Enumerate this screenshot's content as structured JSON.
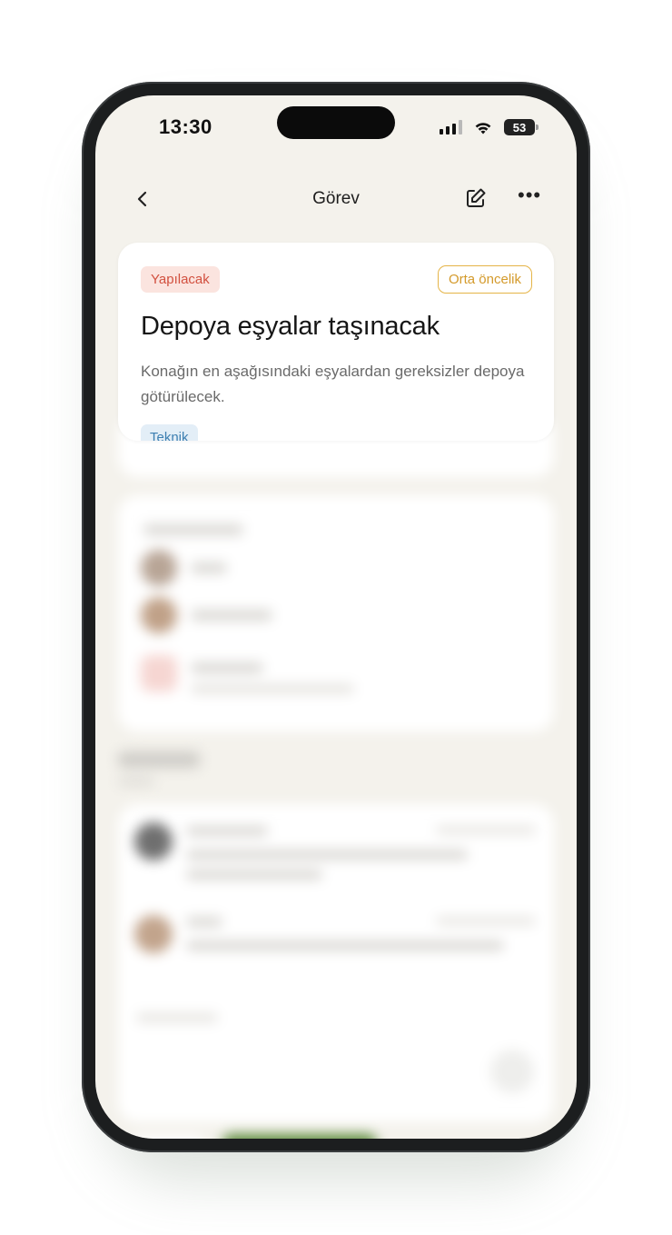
{
  "status_bar": {
    "time": "13:30",
    "battery": "53"
  },
  "nav": {
    "title": "Görev"
  },
  "task": {
    "status": "Yapılacak",
    "priority": "Orta öncelik",
    "title": "Depoya eşyalar taşınacak",
    "description": "Konağın en aşağısındaki eşyalardan gereksizler depoya götürülecek.",
    "tag": "Teknik"
  },
  "colors": {
    "status_bg": "#fbe4df",
    "status_text": "#d2503f",
    "priority_border": "#e5b447",
    "tag_bg": "#e3eef7",
    "tag_text": "#3d7fb1",
    "primary_green": "#5b8a3a"
  },
  "icons": {
    "back": "chevron-left-icon",
    "edit": "pencil-icon",
    "more": "ellipsis-icon",
    "signal": "cellular-signal-icon",
    "wifi": "wifi-icon",
    "battery": "battery-icon"
  }
}
